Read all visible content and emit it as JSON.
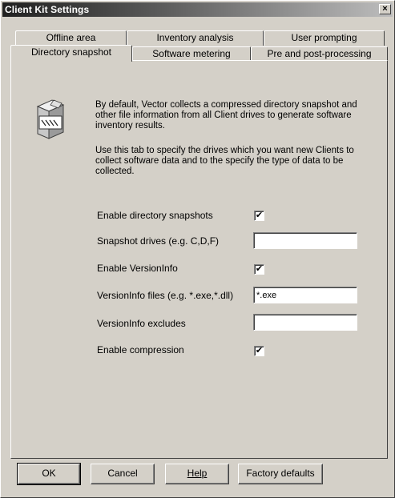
{
  "window": {
    "title": "Client Kit Settings",
    "close_glyph": "×"
  },
  "tabs_row_back": [
    {
      "label": "Offline area"
    },
    {
      "label": "Inventory analysis"
    },
    {
      "label": "User prompting"
    }
  ],
  "tabs_row_front": [
    {
      "label": "Directory snapshot",
      "selected": true
    },
    {
      "label": "Software metering"
    },
    {
      "label": "Pre and post-processing"
    }
  ],
  "description": {
    "icon": "software-package-icon",
    "paragraph1": "By default, Vector collects a compressed directory snapshot and other file information from all Client drives to generate software inventory results.",
    "paragraph2": "Use this tab to specify the drives which you want new Clients to collect software data and to the specify the type of data to be collected."
  },
  "settings": {
    "enable_snapshots": {
      "label": "Enable directory snapshots",
      "checked": true,
      "mark": "✔"
    },
    "snapshot_drives": {
      "label": "Snapshot drives (e.g. C,D,F)",
      "value": ""
    },
    "enable_versioninfo": {
      "label": "Enable VersionInfo",
      "checked": true,
      "mark": "✔"
    },
    "versioninfo_files": {
      "label": "VersionInfo files (e.g. *.exe,*.dll)",
      "value": "*.exe"
    },
    "versioninfo_excludes": {
      "label": "VersionInfo excludes",
      "value": ""
    },
    "enable_compression": {
      "label": "Enable compression",
      "checked": true,
      "mark": "✔"
    }
  },
  "buttons": {
    "ok": "OK",
    "cancel": "Cancel",
    "help": "Help",
    "factory_defaults": "Factory defaults"
  }
}
